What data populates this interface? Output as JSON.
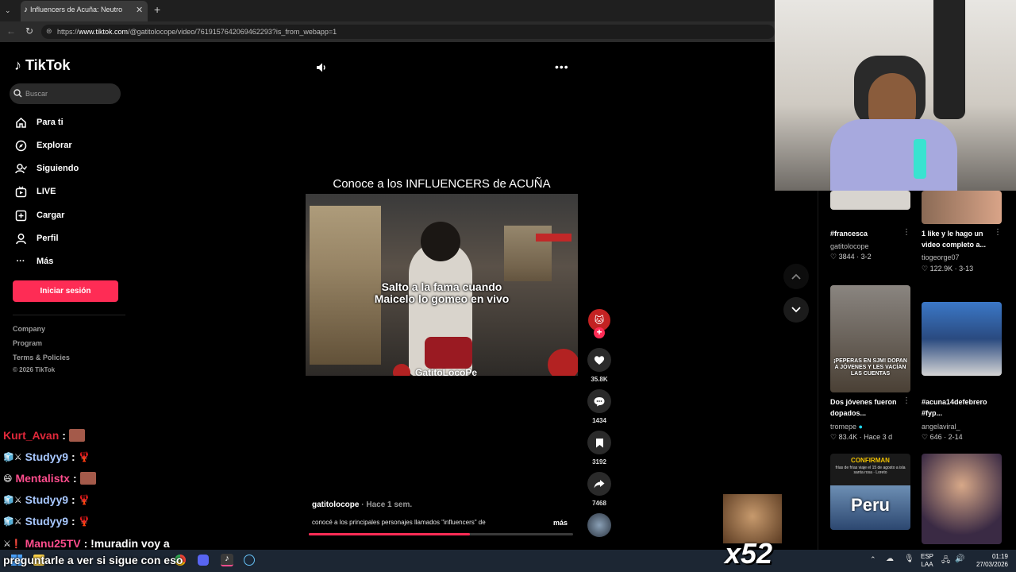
{
  "browser": {
    "tab_title": "Influencers de Acuña: Neutro",
    "url_prefix": "https://",
    "url_host": "www.tiktok.com",
    "url_path": "/@gatitolocope/video/7619157642069462293?is_from_webapp=1"
  },
  "sidebar": {
    "logo": "TikTok",
    "search_placeholder": "Buscar",
    "items": [
      {
        "label": "Para ti",
        "icon": "home-icon"
      },
      {
        "label": "Explorar",
        "icon": "compass-icon"
      },
      {
        "label": "Siguiendo",
        "icon": "following-icon"
      },
      {
        "label": "LIVE",
        "icon": "live-icon"
      },
      {
        "label": "Cargar",
        "icon": "upload-icon"
      },
      {
        "label": "Perfil",
        "icon": "profile-icon"
      },
      {
        "label": "Más",
        "icon": "more-icon"
      }
    ],
    "login_label": "Iniciar sesión",
    "footer": [
      "Company",
      "Program",
      "Terms & Policies",
      "© 2026 TikTok"
    ]
  },
  "video": {
    "title": "Conoce a los INFLUENCERS de ACUÑA",
    "caption_line1": "Salto a la fama cuando",
    "caption_line2": "Maicelo lo gomeo en vivo",
    "watermark": "GatitoLocoPe",
    "author": "gatitolocope",
    "posted": "· Hace 1 sem.",
    "description": "conocé a los principales  personajes llamados \"influencers\" de",
    "more_label": "más",
    "progress": 0.61
  },
  "actions": {
    "likes": "35.8K",
    "comments": "1434",
    "saves": "3192",
    "shares": "7468"
  },
  "related": [
    {
      "title": "#francesca",
      "author": "gatitolocope",
      "meta": "♡ 3844 · 3-2"
    },
    {
      "title": "1 like y le hago un video completo a...",
      "author": "tiogeorge07",
      "meta": "♡ 122.9K · 3-13"
    },
    {
      "title": "Dos jóvenes fueron dopados...",
      "author": "tromepe",
      "meta": "♡ 83.4K · Hace 3 d",
      "thumb_text": "¡PEPERAS EN SJM! DOPAN A JÓVENES Y LES VACÍAN LAS CUENTAS"
    },
    {
      "title": "#acuna14defebrero #fyp...",
      "author": "angelaviral_",
      "meta": "♡ 646 · 2-14"
    },
    {
      "thumb_top": "CONFIRMAN",
      "thumb_sub": "frías de frías viaje el 15 de agosto a isla santa rosa · Loreto",
      "thumb_big": "Peru"
    }
  ],
  "chat": [
    {
      "user": "Kurt_Avan",
      "color": "#e0283a",
      "text": ":"
    },
    {
      "user": "Studyy9",
      "color": "#a8c8ff",
      "text": ":"
    },
    {
      "user": "Mentalistx",
      "color": "#ff4d8d",
      "text": ":"
    },
    {
      "user": "Studyy9",
      "color": "#a8c8ff",
      "text": ":"
    },
    {
      "user": "Studyy9",
      "color": "#a8c8ff",
      "text": ":"
    },
    {
      "user": "Manu25TV",
      "color": "#ff4d8d",
      "text": ": !muradin voy a"
    },
    {
      "user": "",
      "color": "#ffffff",
      "text": "preguntarle a ver si sigue con eso"
    }
  ],
  "overlay": {
    "multiplier": "x52"
  },
  "taskbar": {
    "lang1": "ESP",
    "lang2": "LAA",
    "time": "01:19",
    "date": "27/03/2026"
  }
}
